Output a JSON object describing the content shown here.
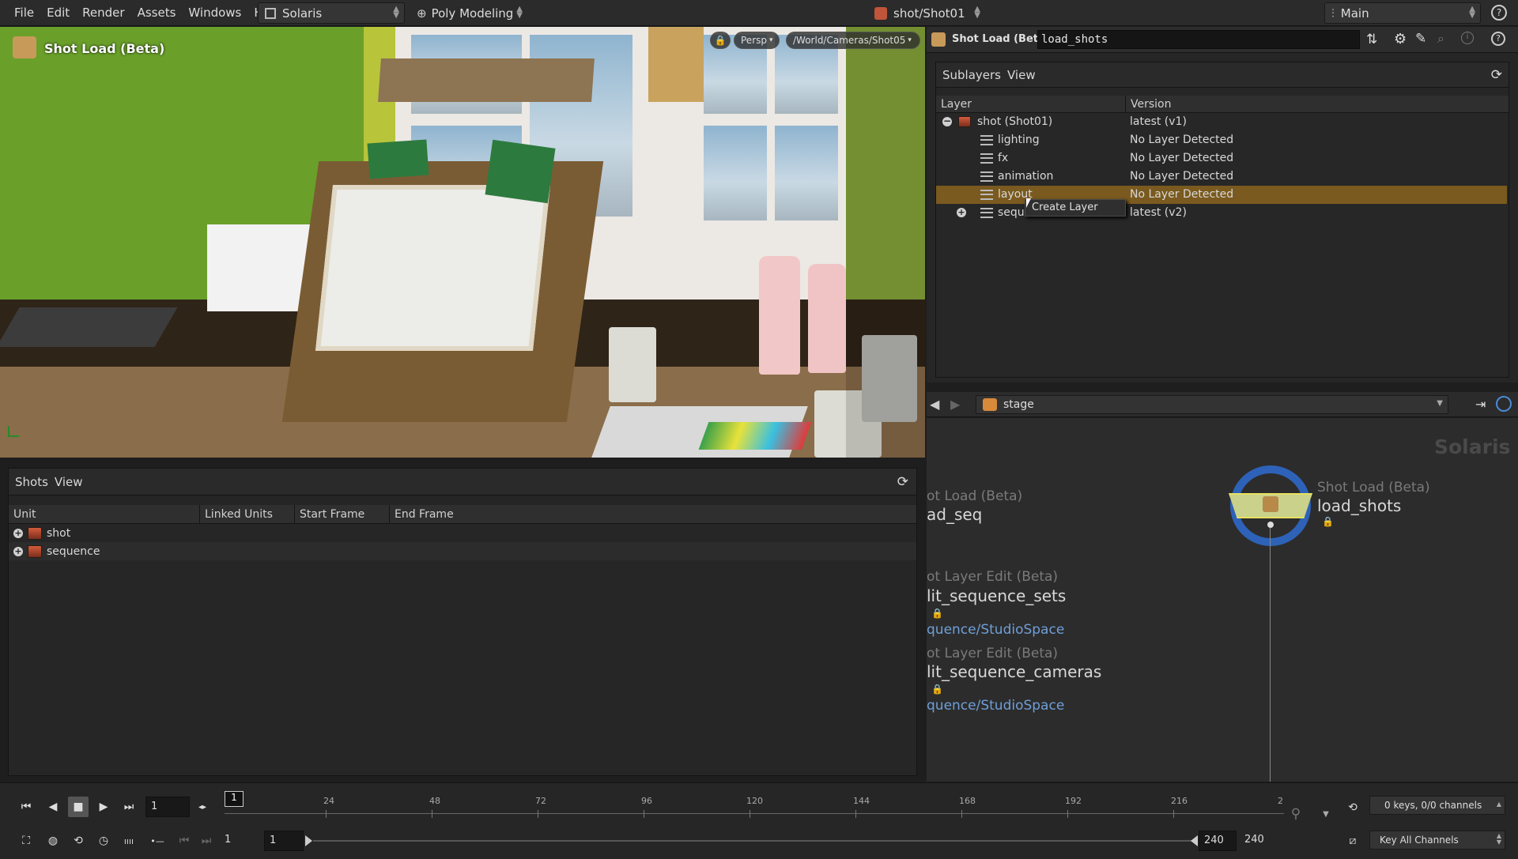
{
  "menubar": {
    "items": [
      "File",
      "Edit",
      "Render",
      "Assets",
      "Windows",
      "Help"
    ],
    "desktop": "Solaris",
    "shelf": "Poly Modeling",
    "context": "shot/Shot01",
    "pane_tab": "Main",
    "help_label": "?"
  },
  "viewport": {
    "title": "Shot Load (Beta)",
    "camera_mode": "Persp",
    "camera_path": "/World/Cameras/Shot05"
  },
  "shots_panel": {
    "tabs": [
      "Shots",
      "View"
    ],
    "columns": [
      "Unit",
      "Linked Units",
      "Start Frame",
      "End Frame"
    ],
    "rows": [
      {
        "unit": "shot"
      },
      {
        "unit": "sequence"
      }
    ]
  },
  "param_bar": {
    "node_type": "Shot Load (Beta)",
    "node_name": "load_shots"
  },
  "layer_panel": {
    "tabs": [
      "Sublayers",
      "View"
    ],
    "columns": [
      "Layer",
      "Version"
    ],
    "rows": [
      {
        "name": "shot (Shot01)",
        "version": "latest (v1)"
      },
      {
        "name": "lighting",
        "version": "No Layer Detected"
      },
      {
        "name": "fx",
        "version": "No Layer Detected"
      },
      {
        "name": "animation",
        "version": "No Layer Detected"
      },
      {
        "name": "layout",
        "version": "No Layer Detected"
      },
      {
        "name": "seque",
        "version": "latest (v2)"
      }
    ],
    "context_menu": "Create Layer"
  },
  "network": {
    "path": "stage",
    "watermark": "Solaris",
    "nodes": [
      {
        "category": "ot Load (Beta)",
        "name": "ad_seq"
      },
      {
        "category": "ot Layer Edit (Beta)",
        "name": "lit_sequence_sets",
        "path": "quence/StudioSpace"
      },
      {
        "category": "ot Layer Edit (Beta)",
        "name": "lit_sequence_cameras",
        "path": "quence/StudioSpace"
      },
      {
        "category": "Shot Load (Beta)",
        "name": "load_shots"
      }
    ]
  },
  "timeline": {
    "current_frame": "1",
    "frame_marker": "1",
    "ticks": [
      "24",
      "48",
      "72",
      "96",
      "120",
      "144",
      "168",
      "192",
      "216",
      "2"
    ],
    "range_start_a": "1",
    "range_start_b": "1",
    "range_end_a": "240",
    "range_end_b": "240",
    "keys_status": "0 keys, 0/0 channels",
    "key_all": "Key All Channels"
  },
  "colors": {
    "selection_row": "#7a5a1e",
    "link_blue": "#6f9fd8",
    "node_ring": "#2d62b8"
  }
}
